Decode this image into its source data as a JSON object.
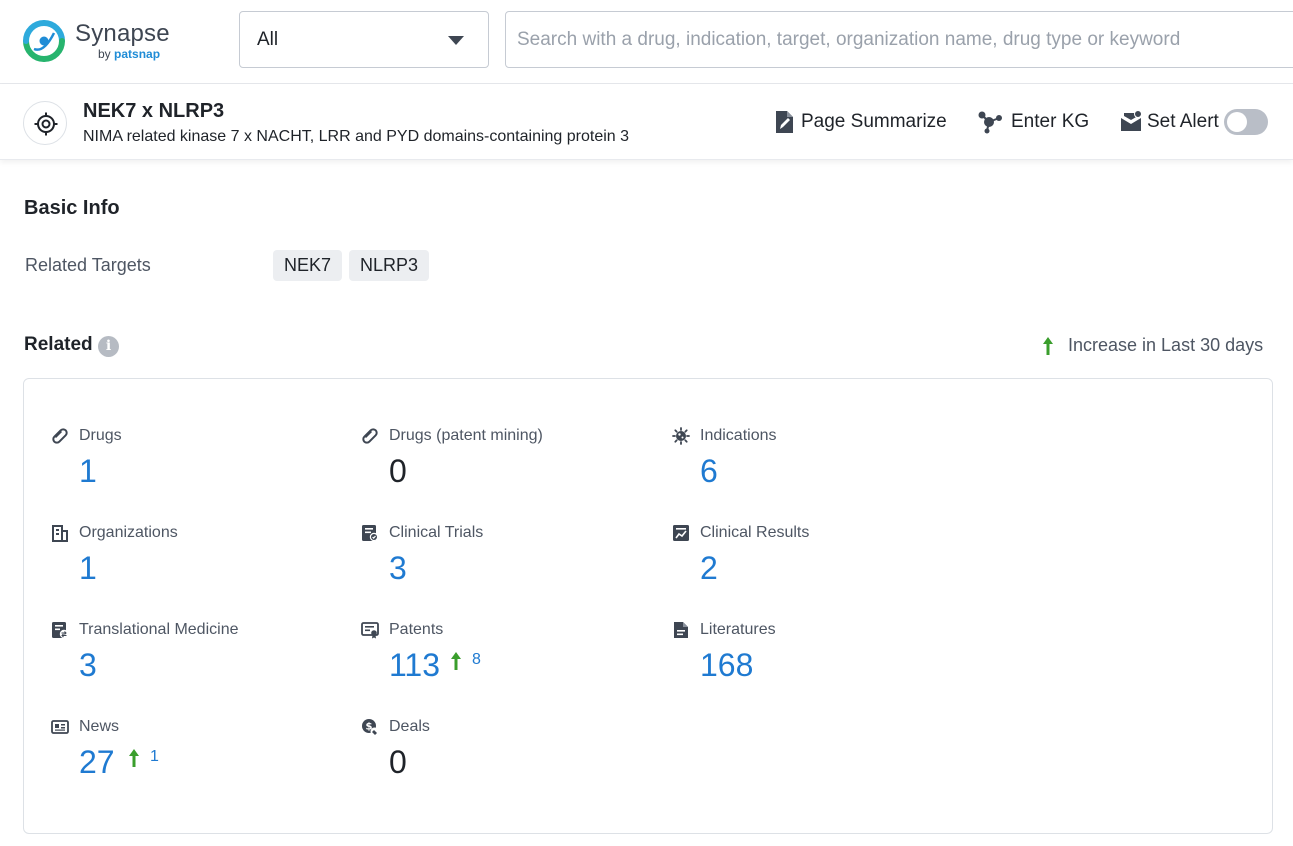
{
  "app": {
    "name": "Synapse",
    "by_prefix": "by",
    "by_brand": "patsnap"
  },
  "search": {
    "scope_value": "All",
    "placeholder": "Search with a drug, indication, target, organization name, drug type or keyword",
    "value": ""
  },
  "entity": {
    "title": "NEK7 x NLRP3",
    "subtitle": "NIMA related kinase 7 x NACHT, LRR and PYD domains-containing protein 3",
    "actions": {
      "summarize": "Page Summarize",
      "kg": "Enter KG",
      "alert": "Set Alert"
    },
    "alert_enabled": false
  },
  "basic_info": {
    "title": "Basic Info",
    "related_targets_label": "Related Targets",
    "related_targets": [
      "NEK7",
      "NLRP3"
    ]
  },
  "related": {
    "title": "Related",
    "legend": "Increase in Last 30 days",
    "stats": [
      {
        "label": "Drugs",
        "value": "1",
        "icon": "pill-icon"
      },
      {
        "label": "Drugs (patent mining)",
        "value": "0",
        "icon": "pill-icon"
      },
      {
        "label": "Indications",
        "value": "6",
        "icon": "virus-icon"
      },
      {
        "label": "Organizations",
        "value": "1",
        "icon": "building-icon"
      },
      {
        "label": "Clinical Trials",
        "value": "3",
        "icon": "clinical-trial-icon"
      },
      {
        "label": "Clinical Results",
        "value": "2",
        "icon": "clinical-result-icon"
      },
      {
        "label": "Translational Medicine",
        "value": "3",
        "icon": "translational-icon"
      },
      {
        "label": "Patents",
        "value": "113",
        "increase": "8",
        "icon": "patent-icon"
      },
      {
        "label": "Literatures",
        "value": "168",
        "icon": "document-icon"
      },
      {
        "label": "News",
        "value": "27",
        "increase": "1",
        "icon": "newspaper-icon"
      },
      {
        "label": "Deals",
        "value": "0",
        "icon": "deal-icon"
      }
    ]
  },
  "colors": {
    "link_blue": "#1f7ad1",
    "increase_green": "#3a9e2c",
    "text_dark": "#1f2329",
    "text_muted": "#4e5663"
  }
}
